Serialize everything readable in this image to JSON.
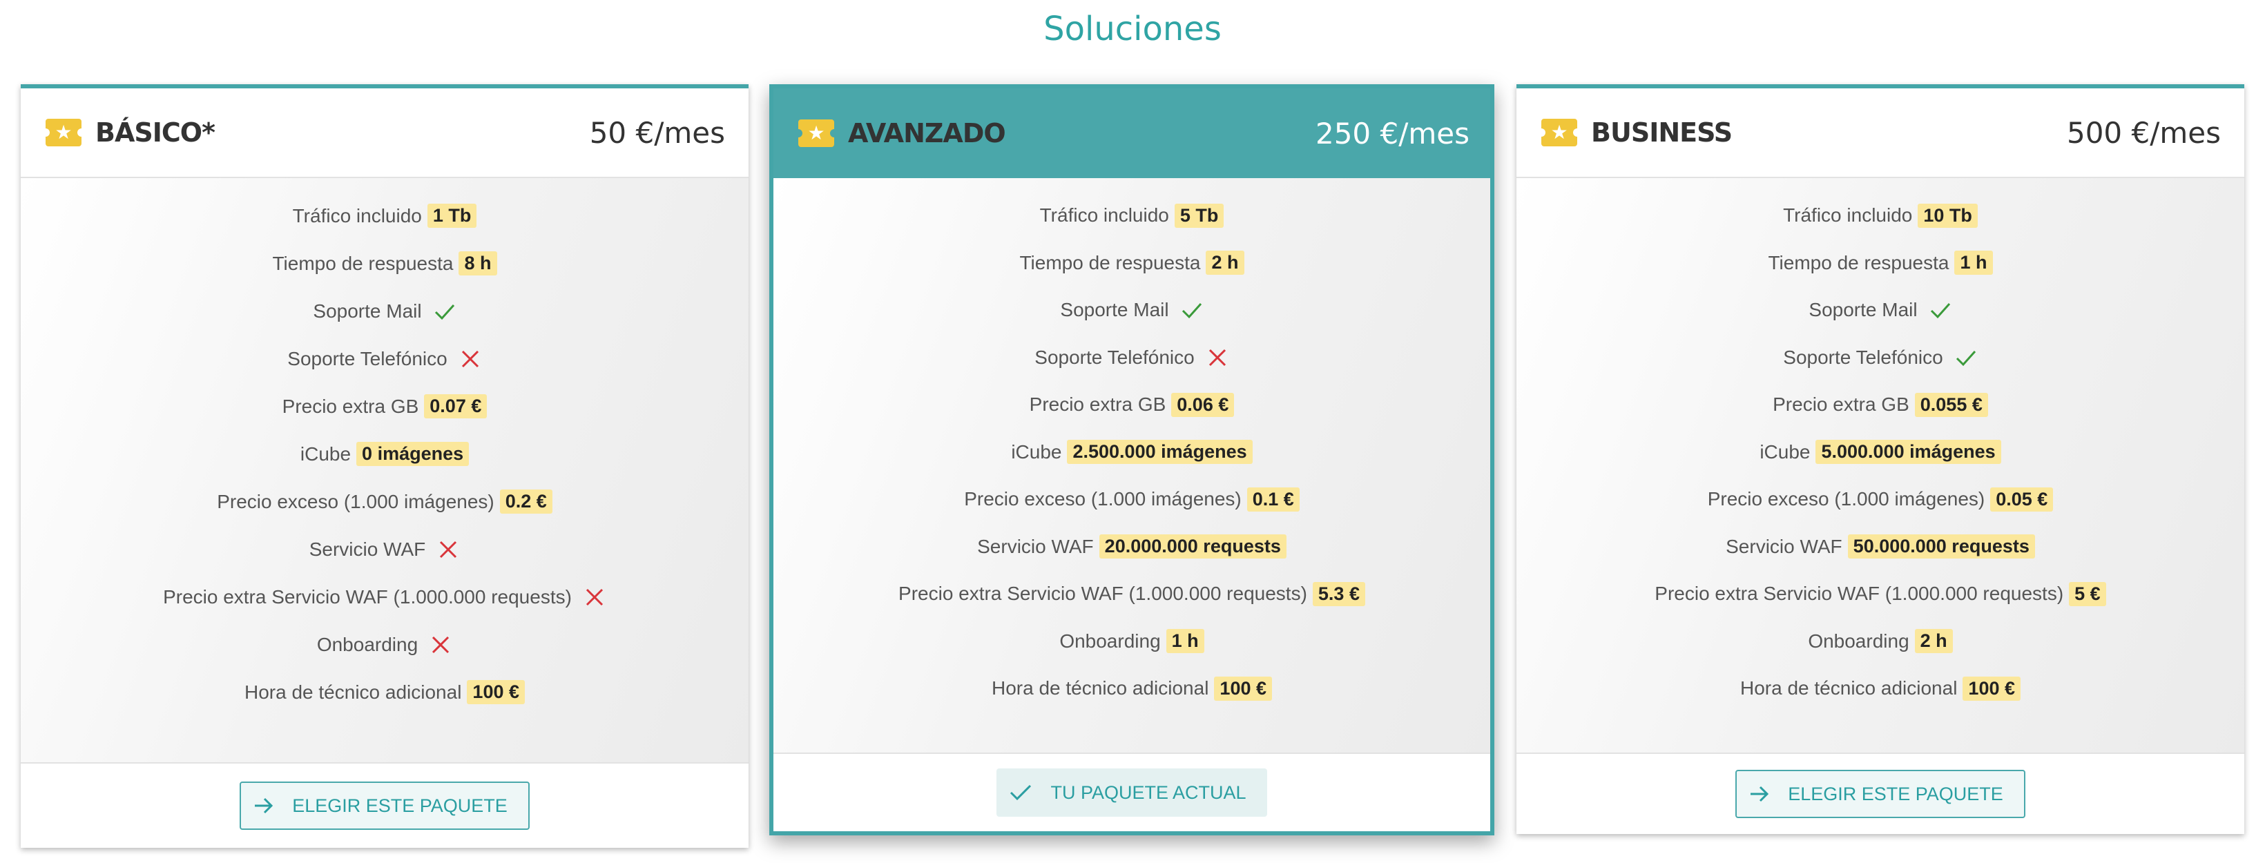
{
  "page_title": "Soluciones",
  "colors": {
    "accent": "#44a5a8",
    "badge": "#fbe79b",
    "check": "#3a9a3a",
    "cross": "#d9343a"
  },
  "plans": [
    {
      "name": "BÁSICO*",
      "price": "50 €/mes",
      "selected": false,
      "button_label": "ELEGIR ESTE PAQUETE",
      "button_icon": "arrow-right-icon",
      "features": [
        {
          "label": "Tráfico incluido",
          "value": "1 Tb"
        },
        {
          "label": "Tiempo de respuesta",
          "value": "8 h"
        },
        {
          "label": "Soporte Mail",
          "status": "check"
        },
        {
          "label": "Soporte Telefónico",
          "status": "cross"
        },
        {
          "label": "Precio extra GB",
          "value": "0.07 €"
        },
        {
          "label": "iCube",
          "value": "0 imágenes"
        },
        {
          "label": "Precio exceso (1.000 imágenes)",
          "value": "0.2 €"
        },
        {
          "label": "Servicio WAF",
          "status": "cross"
        },
        {
          "label": "Precio extra Servicio WAF (1.000.000 requests)",
          "status": "cross"
        },
        {
          "label": "Onboarding",
          "status": "cross"
        },
        {
          "label": "Hora de técnico adicional",
          "value": "100 €"
        }
      ]
    },
    {
      "name": "AVANZADO",
      "price": "250 €/mes",
      "selected": true,
      "button_label": "TU PAQUETE ACTUAL",
      "button_icon": "check-icon",
      "features": [
        {
          "label": "Tráfico incluido",
          "value": "5 Tb"
        },
        {
          "label": "Tiempo de respuesta",
          "value": "2 h"
        },
        {
          "label": "Soporte Mail",
          "status": "check"
        },
        {
          "label": "Soporte Telefónico",
          "status": "cross"
        },
        {
          "label": "Precio extra GB",
          "value": "0.06 €"
        },
        {
          "label": "iCube",
          "value": "2.500.000 imágenes"
        },
        {
          "label": "Precio exceso (1.000 imágenes)",
          "value": "0.1 €"
        },
        {
          "label": "Servicio WAF",
          "value": "20.000.000 requests"
        },
        {
          "label": "Precio extra Servicio WAF (1.000.000 requests)",
          "value": "5.3 €"
        },
        {
          "label": "Onboarding",
          "value": "1 h"
        },
        {
          "label": "Hora de técnico adicional",
          "value": "100 €"
        }
      ]
    },
    {
      "name": "BUSINESS",
      "price": "500 €/mes",
      "selected": false,
      "button_label": "ELEGIR ESTE PAQUETE",
      "button_icon": "arrow-right-icon",
      "features": [
        {
          "label": "Tráfico incluido",
          "value": "10 Tb"
        },
        {
          "label": "Tiempo de respuesta",
          "value": "1 h"
        },
        {
          "label": "Soporte Mail",
          "status": "check"
        },
        {
          "label": "Soporte Telefónico",
          "status": "check"
        },
        {
          "label": "Precio extra GB",
          "value": "0.055 €"
        },
        {
          "label": "iCube",
          "value": "5.000.000 imágenes"
        },
        {
          "label": "Precio exceso (1.000 imágenes)",
          "value": "0.05 €"
        },
        {
          "label": "Servicio WAF",
          "value": "50.000.000 requests"
        },
        {
          "label": "Precio extra Servicio WAF (1.000.000 requests)",
          "value": "5 €"
        },
        {
          "label": "Onboarding",
          "value": "2 h"
        },
        {
          "label": "Hora de técnico adicional",
          "value": "100 €"
        }
      ]
    }
  ]
}
